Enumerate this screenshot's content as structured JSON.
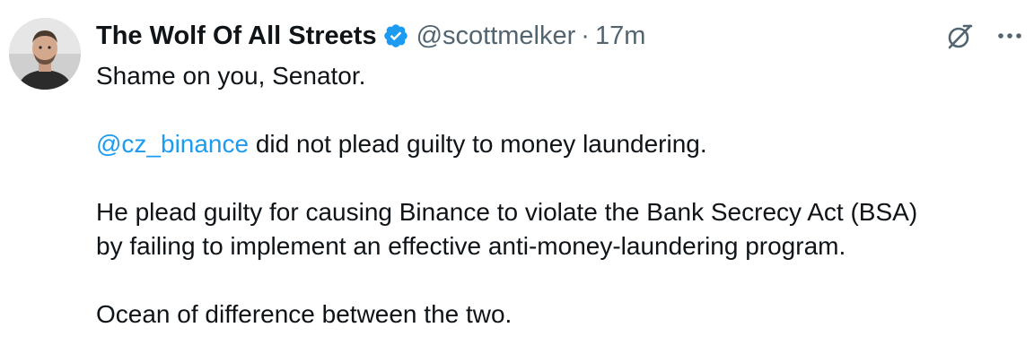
{
  "tweet": {
    "author": {
      "display_name": "The Wolf Of All Streets",
      "handle": "@scottmelker",
      "verified": true
    },
    "separator": "·",
    "timestamp": "17m",
    "paragraphs": {
      "p1": "Shame on you, Senator.",
      "p2_mention": "@cz_binance",
      "p2_rest": " did not plead guilty to money laundering.",
      "p3_line1": "He plead guilty for causing Binance to violate the Bank Secrecy Act (BSA)",
      "p3_line2": "by failing to implement an effective anti-money-laundering program.",
      "p4": "Ocean of difference between the two."
    }
  },
  "icons": {
    "verified": "verified-badge-icon",
    "grok": "grok-icon",
    "more": "more-dots-icon"
  },
  "colors": {
    "text": "#0f1419",
    "secondary": "#536471",
    "link": "#1d9bf0",
    "verified": "#1d9bf0"
  }
}
